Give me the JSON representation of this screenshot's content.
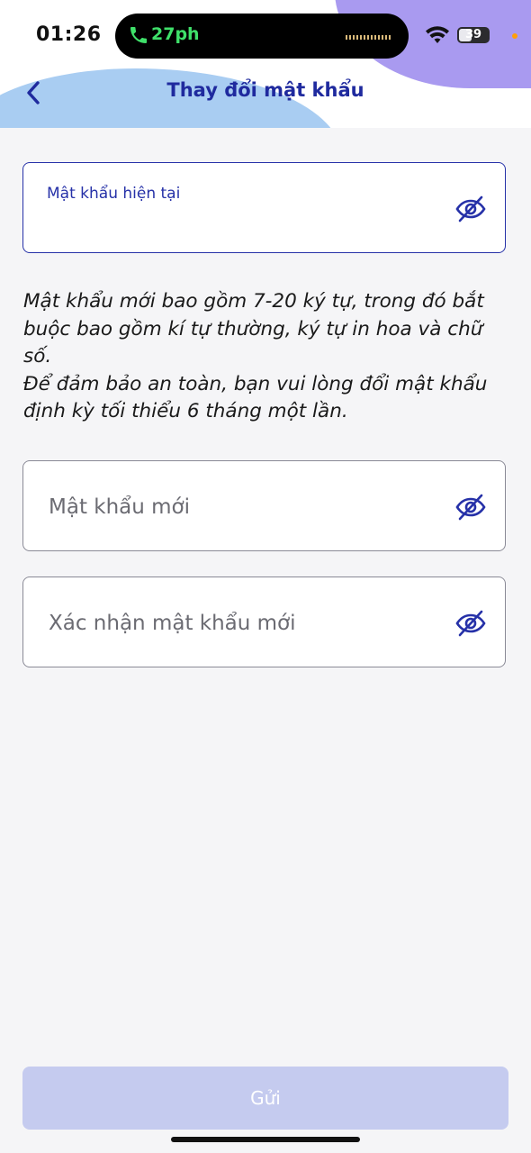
{
  "status_bar": {
    "time": "01:26",
    "call_duration": "27ph",
    "battery": "39"
  },
  "header": {
    "title": "Thay đổi mật khẩu"
  },
  "current_password": {
    "label": "Mật khẩu hiện tại",
    "value": ""
  },
  "info": {
    "line1": "Mật khẩu mới bao gồm 7-20 ký tự, trong đó bắt buộc bao gồm kí tự thường, ký tự in hoa và chữ số.",
    "line2": "Để đảm bảo an toàn, bạn vui lòng đổi mật khẩu định kỳ tối thiểu 6 tháng một lần."
  },
  "new_password": {
    "placeholder": "Mật khẩu mới",
    "value": ""
  },
  "confirm_password": {
    "placeholder": "Xác nhận mật khẩu mới",
    "value": ""
  },
  "submit": {
    "label": "Gửi"
  },
  "colors": {
    "accent": "#2631a8",
    "submit_disabled": "#c5cbef",
    "header_blue": "#a9cdf2",
    "header_purple": "#a99af0"
  },
  "icons": {
    "back": "chevron-left-icon",
    "visibility": "eye-off-icon",
    "call": "phone-icon",
    "wifi": "wifi-icon"
  }
}
